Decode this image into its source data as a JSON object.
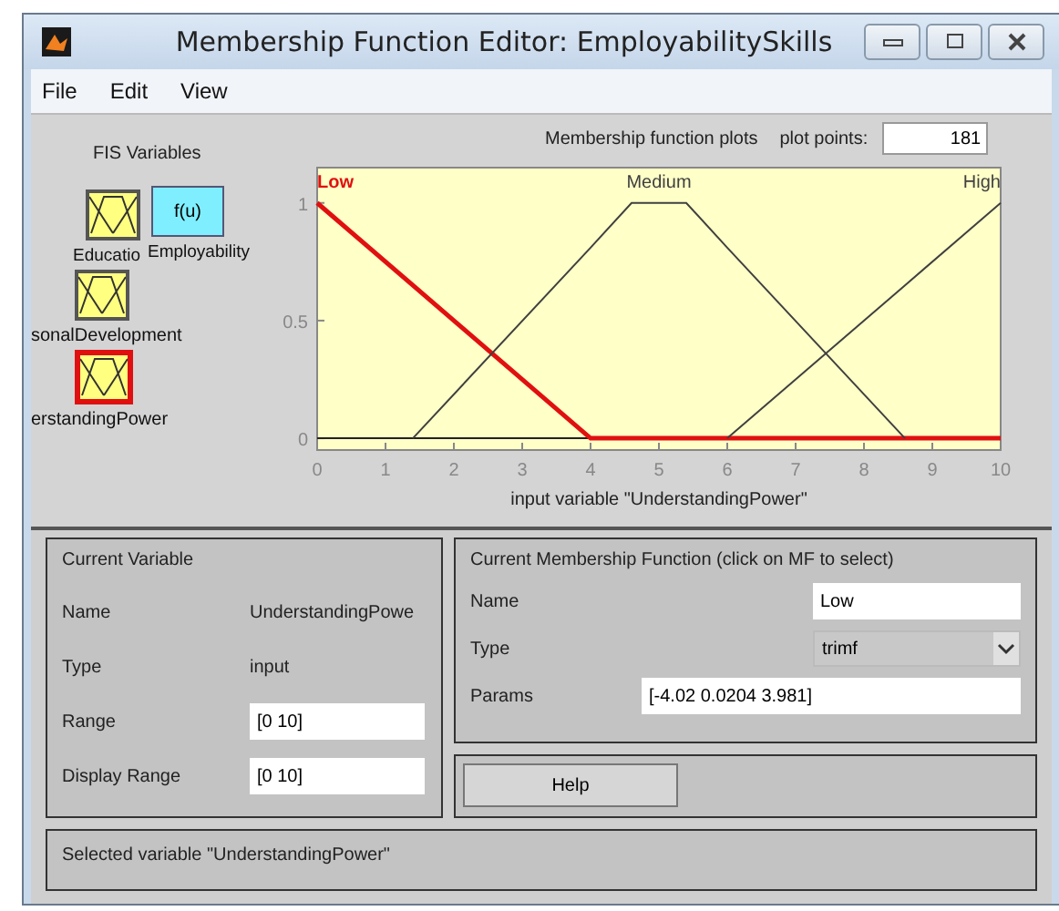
{
  "window": {
    "title": "Membership Function Editor: EmployabilitySkills"
  },
  "menu": [
    "File",
    "Edit",
    "View"
  ],
  "fis_variables": {
    "title": "FIS Variables",
    "items": [
      {
        "kind": "input",
        "label": "Educatio",
        "selected": false
      },
      {
        "kind": "output",
        "label": "Employability",
        "symbol": "f(u)",
        "selected": false
      },
      {
        "kind": "input",
        "label": "sonalDevelopment",
        "selected": false
      },
      {
        "kind": "input",
        "label": "erstandingPower",
        "selected": true
      }
    ]
  },
  "plot_header": {
    "title": "Membership function plots",
    "points_label": "plot points:",
    "points_value": "181"
  },
  "plot": {
    "curves": [
      {
        "selected": true
      },
      {
        "selected": false
      },
      {
        "selected": false
      }
    ],
    "chart_data": {
      "type": "line",
      "xlabel": "input variable \"UnderstandingPower\"",
      "x": [
        0,
        1.4,
        4,
        4.6,
        5.4,
        6,
        8.6,
        10
      ],
      "xlim": [
        0,
        10
      ],
      "ylim": [
        -0.05,
        1.15
      ],
      "xticks": [
        0,
        1,
        2,
        3,
        4,
        5,
        6,
        7,
        8,
        9,
        10
      ],
      "yticks": [
        0,
        0.5,
        1
      ],
      "series": [
        {
          "name": "Low",
          "color": "#e01010",
          "values": [
            1,
            0.65,
            0,
            0,
            0,
            0,
            0,
            0
          ]
        },
        {
          "name": "Medium",
          "color": "#404040",
          "values": [
            null,
            0,
            0.81,
            1,
            1,
            0.81,
            0,
            null
          ]
        },
        {
          "name": "High",
          "color": "#404040",
          "values": [
            null,
            null,
            null,
            null,
            null,
            0,
            0.65,
            1
          ]
        }
      ]
    }
  },
  "current_variable": {
    "title": "Current Variable",
    "rows": [
      {
        "kind": "text",
        "label": "Name",
        "value": "UnderstandingPowe"
      },
      {
        "kind": "text",
        "label": "Type",
        "value": "input"
      },
      {
        "kind": "field",
        "label": "Range",
        "value": "[0 10]"
      },
      {
        "kind": "field",
        "label": "Display Range",
        "value": "[0 10]"
      }
    ]
  },
  "current_mf": {
    "title": "Current Membership Function (click on MF to select)",
    "name_label": "Name",
    "name_value": "Low",
    "type_label": "Type",
    "type_value": "trimf",
    "params_label": "Params",
    "params_value": "[-4.02 0.0204 3.981]"
  },
  "help_button": "Help",
  "status_bar": "Selected variable \"UnderstandingPower\""
}
